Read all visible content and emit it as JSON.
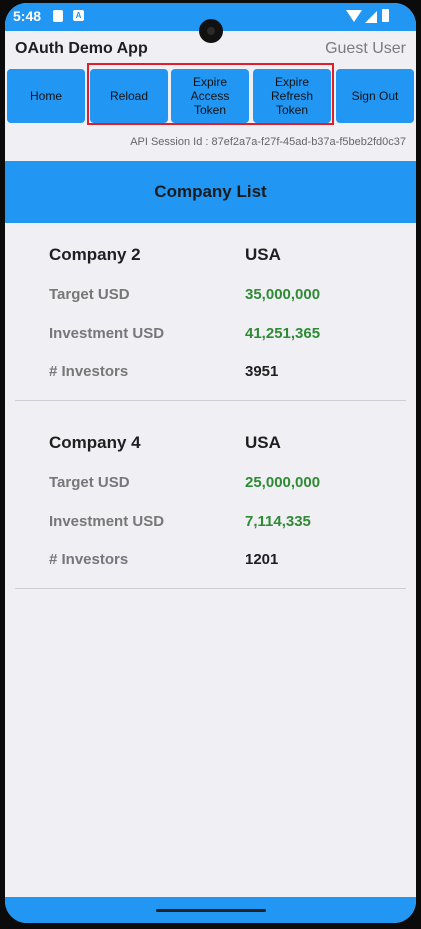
{
  "status_bar": {
    "time": "5:48",
    "a_badge": "A",
    "icons": [
      "sim-icon",
      "a-icon",
      "wifi-icon",
      "signal-icon",
      "battery-icon"
    ]
  },
  "app_bar": {
    "title": "OAuth Demo App",
    "user": "Guest User"
  },
  "nav": {
    "home": "Home",
    "reload": "Reload",
    "expire_access": "Expire Access Token",
    "expire_refresh": "Expire Refresh Token",
    "sign_out": "Sign Out"
  },
  "session_text": "API Session Id : 87ef2a7a-f27f-45ad-b37a-f5beb2fd0c37",
  "list_title": "Company List",
  "companies": [
    {
      "name": "Company 2",
      "country": "USA",
      "target_label": "Target USD",
      "target": "35,000,000",
      "investment_label": "Investment USD",
      "investment": "41,251,365",
      "investors_label": "# Investors",
      "investors": "3951"
    },
    {
      "name": "Company 4",
      "country": "USA",
      "target_label": "Target USD",
      "target": "25,000,000",
      "investment_label": "Investment USD",
      "investment": "7,114,335",
      "investors_label": "# Investors",
      "investors": "1201"
    }
  ],
  "colors": {
    "primary": "#2196f3",
    "money": "#2e8b34",
    "highlight": "#e01e2a",
    "background": "#f0eff4"
  }
}
